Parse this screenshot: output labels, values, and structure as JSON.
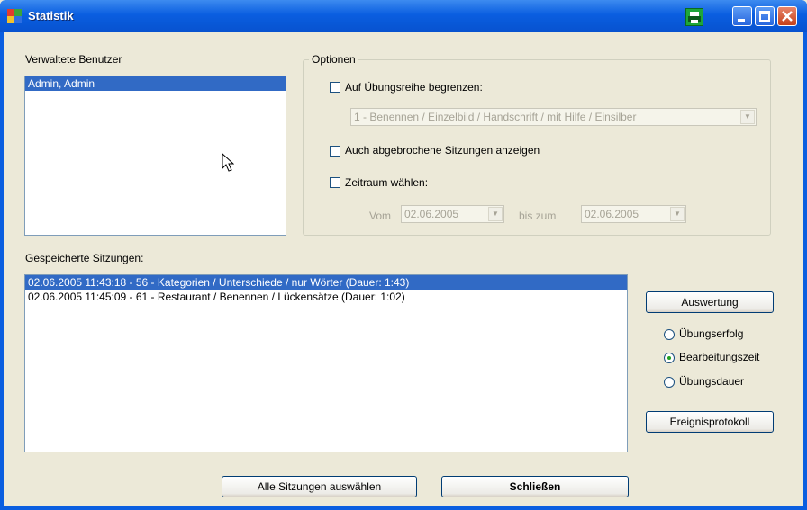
{
  "window": {
    "title": "Statistik"
  },
  "users": {
    "label": "Verwaltete Benutzer",
    "items": [
      "Admin, Admin"
    ]
  },
  "options": {
    "title": "Optionen",
    "limit_series_label": "Auf Übungsreihe begrenzen:",
    "series_select_value": "1 - Benennen / Einzelbild / Handschrift / mit Hilfe / Einsilber",
    "show_aborted_label": "Auch abgebrochene Sitzungen anzeigen",
    "timespan_label": "Zeitraum wählen:",
    "from_label": "Vom",
    "from_value": "02.06.2005",
    "to_label": "bis zum",
    "to_value": "02.06.2005"
  },
  "sessions": {
    "label": "Gespeicherte Sitzungen:",
    "items": [
      "02.06.2005 11:43:18 - 56 - Kategorien / Unterschiede / nur Wörter  (Dauer: 1:43)",
      "02.06.2005 11:45:09 - 61 - Restaurant / Benennen / Lückensätze  (Dauer: 1:02)"
    ]
  },
  "evaluation": {
    "button": "Auswertung",
    "radio_success": "Übungserfolg",
    "radio_time": "Bearbeitungszeit",
    "radio_duration": "Übungsdauer",
    "log_button": "Ereignisprotokoll"
  },
  "footer": {
    "select_all": "Alle Sitzungen auswählen",
    "close": "Schließen"
  }
}
